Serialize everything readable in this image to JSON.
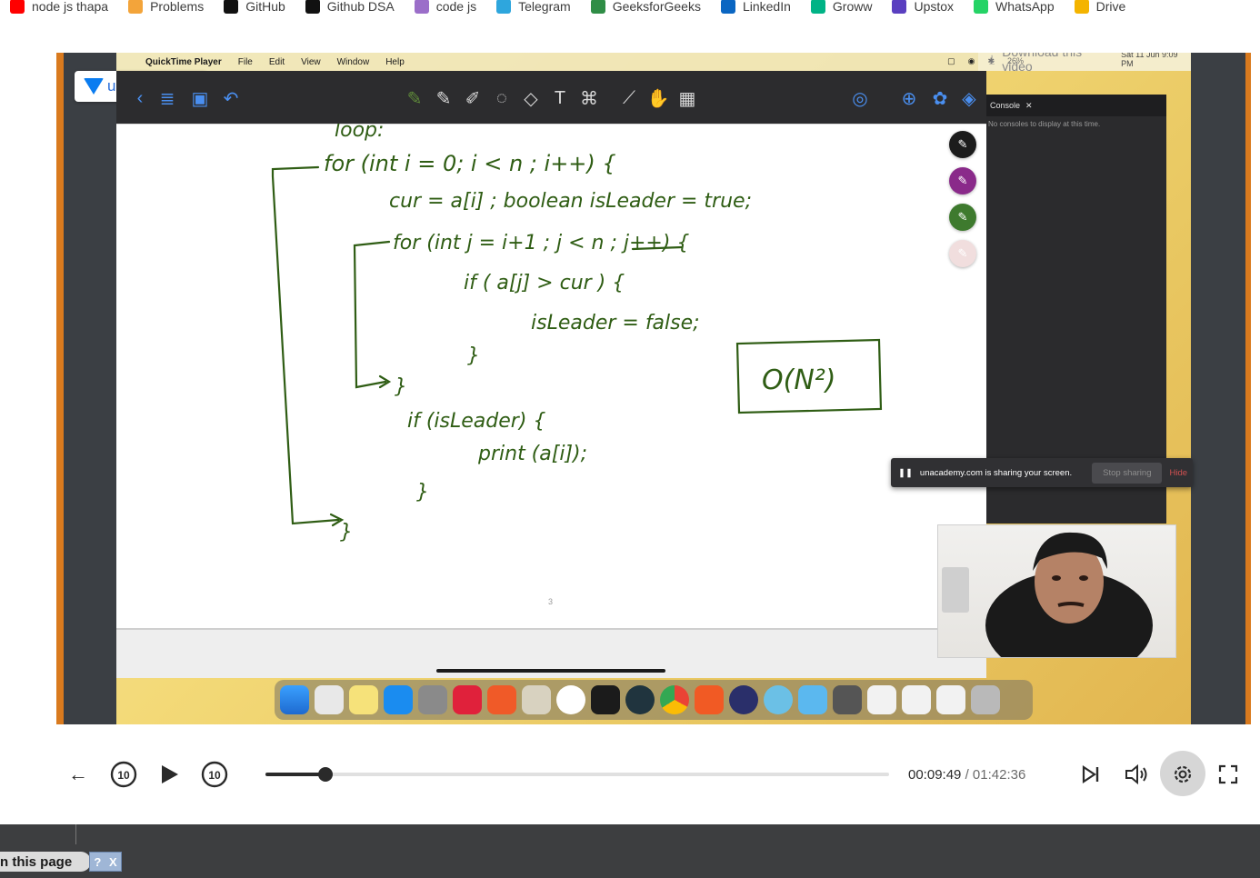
{
  "bookmarks": [
    {
      "label": "node js thapa",
      "icon": "youtube-icon",
      "color": "#ff0000"
    },
    {
      "label": "Problems",
      "icon": "codechef-icon",
      "color": "#f3a43a"
    },
    {
      "label": "GitHub",
      "icon": "github-icon",
      "color": "#111111"
    },
    {
      "label": "Github DSA",
      "icon": "github-icon",
      "color": "#111111"
    },
    {
      "label": "code js",
      "icon": "avatar-icon",
      "color": "#9b6ec9"
    },
    {
      "label": "Telegram",
      "icon": "telegram-icon",
      "color": "#2ea6dd"
    },
    {
      "label": "GeeksforGeeks",
      "icon": "gfg-icon",
      "color": "#2f8d46"
    },
    {
      "label": "LinkedIn",
      "icon": "linkedin-icon",
      "color": "#0a66c2"
    },
    {
      "label": "Groww",
      "icon": "groww-icon",
      "color": "#00b386"
    },
    {
      "label": "Upstox",
      "icon": "upstox-icon",
      "color": "#5a3fc0"
    },
    {
      "label": "WhatsApp",
      "icon": "whatsapp-icon",
      "color": "#25d366"
    },
    {
      "label": "Drive",
      "icon": "drive-icon",
      "color": "#f4b400"
    }
  ],
  "video": {
    "mac_menu": [
      "QuickTime Player",
      "File",
      "Edit",
      "View",
      "Window",
      "Help"
    ],
    "battery": "26%",
    "clock": "Sat 11 Jun  9:09 PM",
    "download_overlay": "Download this video",
    "brand": "unacademy",
    "console": {
      "tab": "Console",
      "message": "No consoles to display at this time."
    },
    "share_bar": {
      "text": "unacademy.com is sharing your screen.",
      "stop": "Stop sharing",
      "hide": "Hide"
    },
    "page_number": "3",
    "whiteboard": {
      "heading": "loop:",
      "code": [
        "for (int i = 0; i < n ; i++) {",
        "cur = a[i] ; boolean isLeader = true;",
        "for (int j = i+1 ; j < n ; j++) {",
        "if ( a[j] > cur ) {",
        "isLeader = false;",
        "}",
        "}",
        "if (isLeader) {",
        "print (a[i]);",
        "}",
        "}"
      ],
      "complexity": "O(N²)"
    }
  },
  "player": {
    "current_time": "00:09:49",
    "separator": "/",
    "total_time": "01:42:36",
    "progress": 0.0956,
    "skip_back": "10",
    "skip_forward": "10"
  },
  "footer": {
    "pill": "n this page",
    "help": "?",
    "close": "X"
  }
}
